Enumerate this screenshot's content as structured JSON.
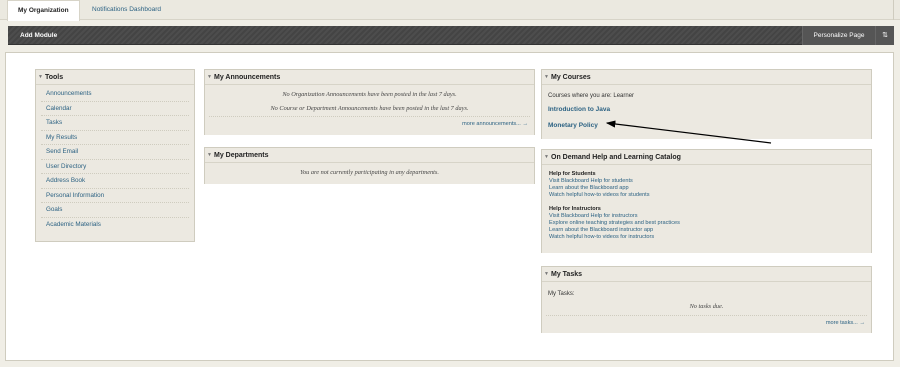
{
  "top_tabs": [
    {
      "label": "My Organization",
      "active": true
    },
    {
      "label": "Notifications Dashboard",
      "active": false
    }
  ],
  "toolbar": {
    "add_module": "Add Module",
    "personalize": "Personalize Page",
    "reorder_icon": "reorder-icon"
  },
  "tools": {
    "title": "Tools",
    "items": [
      "Announcements",
      "Calendar",
      "Tasks",
      "My Results",
      "Send Email",
      "User Directory",
      "Address Book",
      "Personal Information",
      "Goals",
      "Academic Materials"
    ]
  },
  "announcements": {
    "title": "My Announcements",
    "messages": [
      "No Organization Announcements have been posted in the last 7 days.",
      "No Course or Department Announcements have been posted in the last 7 days."
    ],
    "more": "more announcements... →"
  },
  "departments": {
    "title": "My Departments",
    "message": "You are not currently participating in any departments."
  },
  "courses": {
    "title": "My Courses",
    "intro": "Courses where you are: Learner",
    "items": [
      "Introduction to Java",
      "Monetary Policy"
    ]
  },
  "help": {
    "title": "On Demand Help and Learning Catalog",
    "students_heading": "Help for Students",
    "students_links": [
      "Visit Blackboard Help for students",
      "Learn about the Blackboard app",
      "Watch helpful how-to videos for students"
    ],
    "instructors_heading": "Help for Instructors",
    "instructors_links": [
      "Visit Blackboard Help for instructors",
      "Explore online teaching strategies and best practices",
      "Learn about the Blackboard instructor app",
      "Watch helpful how-to videos for instructors"
    ]
  },
  "tasks": {
    "title": "My Tasks",
    "label": "My Tasks:",
    "message": "No tasks due.",
    "more": "more tasks... →"
  },
  "colors": {
    "link": "#2c6283",
    "module_bg": "#ece9e1",
    "toolbar_bg": "#4a4a4a"
  }
}
